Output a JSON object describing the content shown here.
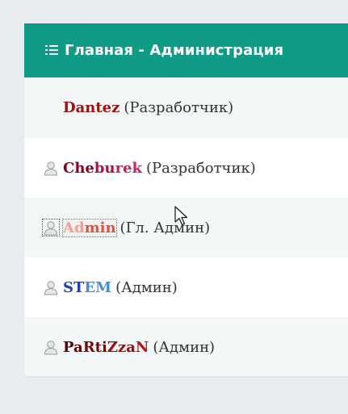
{
  "header": {
    "title": "Главная - Администрация",
    "icon": "list-icon",
    "background": "#0f9b86"
  },
  "users": [
    {
      "name_parts": [
        {
          "text": "Dantez",
          "color": "#a01010"
        }
      ],
      "role": "(Разработчик)",
      "has_avatar": false
    },
    {
      "name_parts": [
        {
          "text": "Che",
          "color": "#8b0020"
        },
        {
          "text": "bu",
          "color": "#b01040"
        },
        {
          "text": "rek",
          "color": "#d0205a"
        }
      ],
      "role": "(Разработчик)",
      "has_avatar": true
    },
    {
      "name_parts": [
        {
          "text": "Ad",
          "color": "#f2a090"
        },
        {
          "text": "min",
          "color": "#e0503a"
        }
      ],
      "role": "(Гл. Админ)",
      "has_avatar": true,
      "selected": true
    },
    {
      "name_parts": [
        {
          "text": "ST",
          "color": "#1f3fb8"
        },
        {
          "text": "EM",
          "color": "#3f8de0"
        }
      ],
      "role": "(Админ)",
      "has_avatar": true
    },
    {
      "name_parts": [
        {
          "text": "Pa",
          "color": "#5a0000"
        },
        {
          "text": "Rti",
          "color": "#7a0505"
        },
        {
          "text": "Zza",
          "color": "#a00a0a"
        },
        {
          "text": "N",
          "color": "#c01010"
        }
      ],
      "role": "(Админ)",
      "has_avatar": true
    }
  ]
}
